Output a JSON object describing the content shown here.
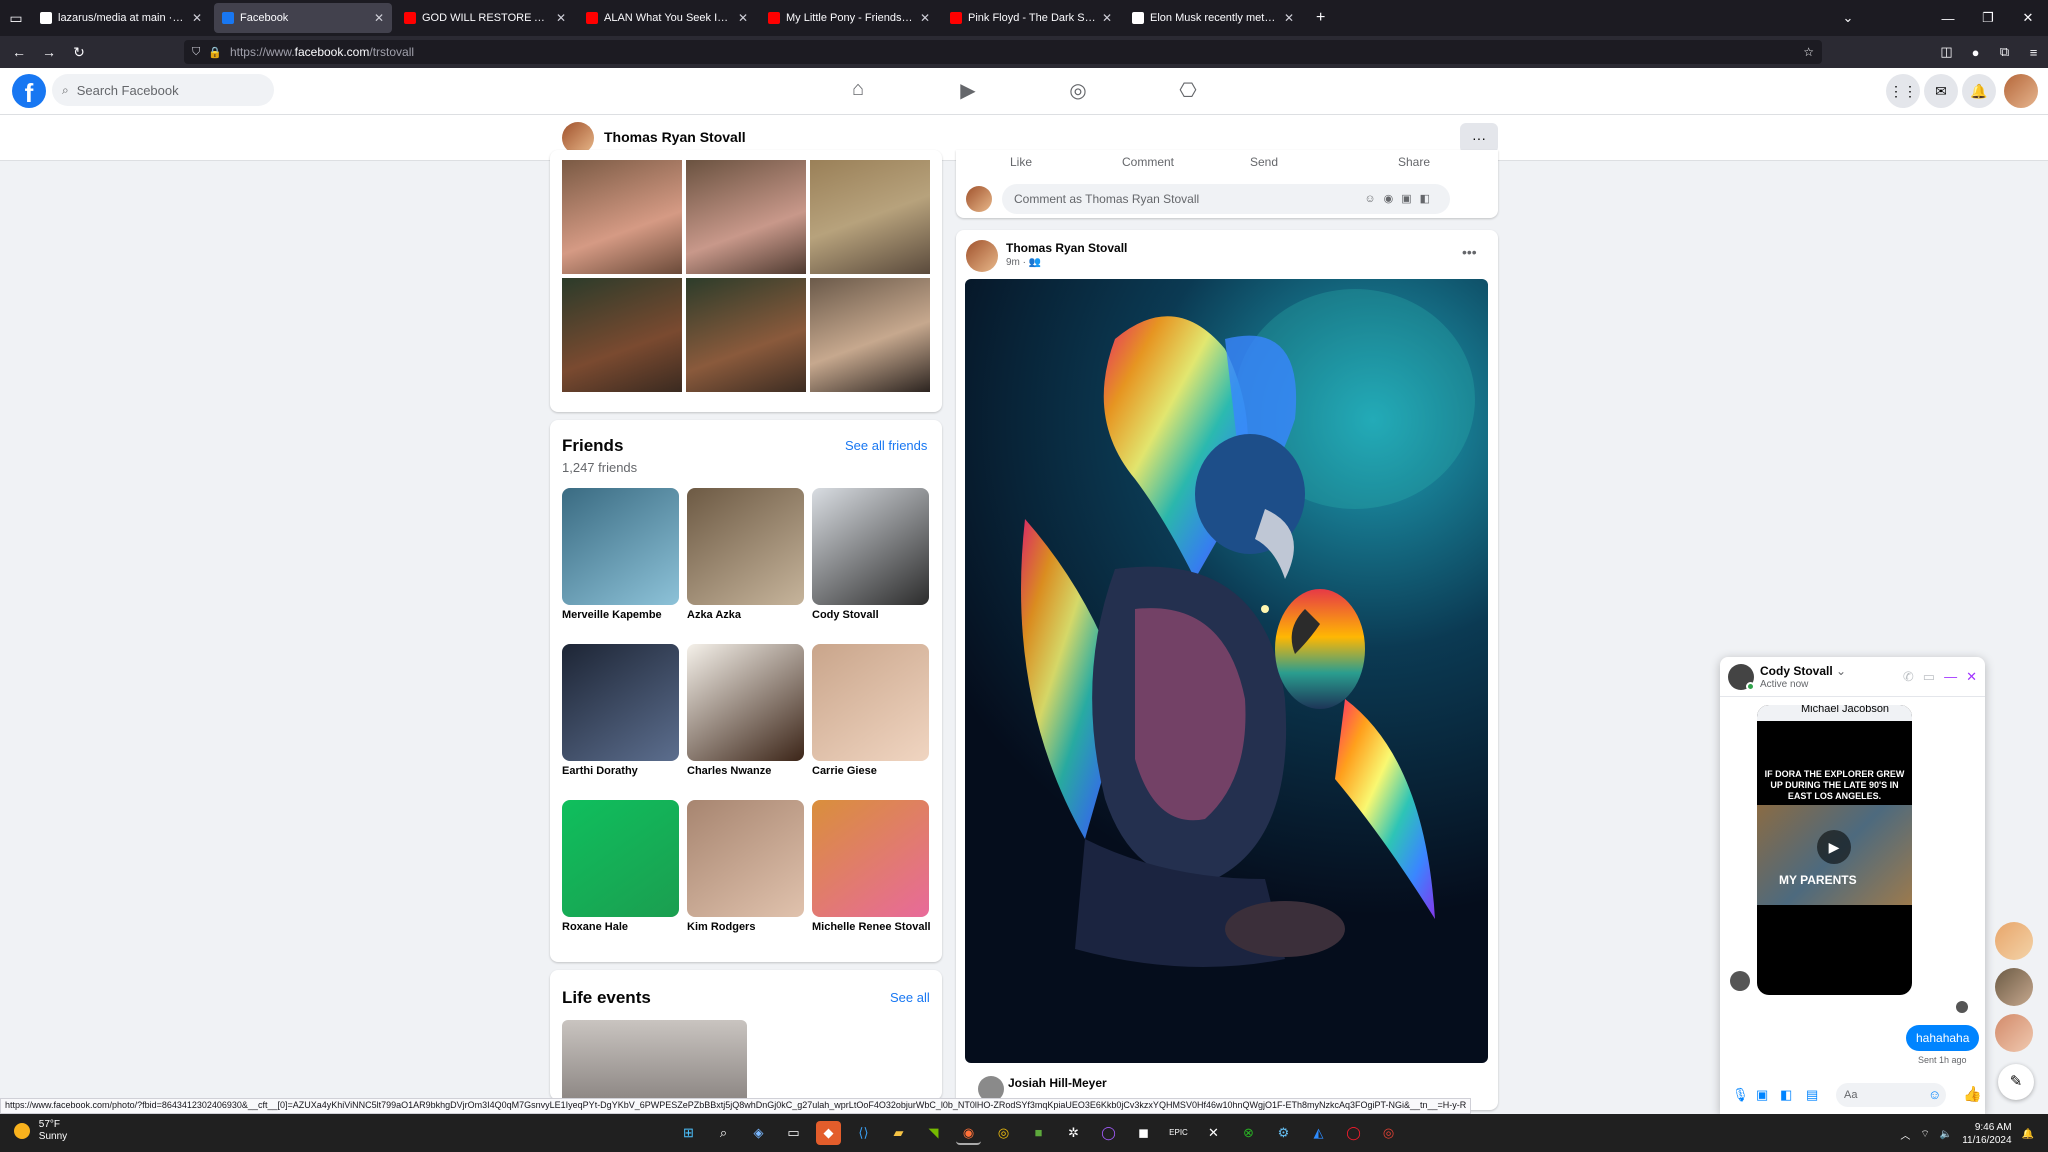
{
  "browser": {
    "tabs": [
      {
        "title": "lazarus/media at main · trstovall",
        "color": "#ffffff",
        "active": false
      },
      {
        "title": "Facebook",
        "color": "#1877f2",
        "active": true
      },
      {
        "title": "GOD WILL RESTORE ALL YOUR",
        "color": "#ff0000",
        "active": false
      },
      {
        "title": "ALAN What You Seek Is Seeking",
        "color": "#ff0000",
        "active": false
      },
      {
        "title": "My Little Pony - Friendship Is M",
        "color": "#ff0000",
        "active": false
      },
      {
        "title": "Pink Floyd - The Dark Side of th",
        "color": "#ff0000",
        "active": false
      },
      {
        "title": "Elon Musk recently met with Ira",
        "color": "#ffffff",
        "active": false
      }
    ],
    "url_prefix": "https://www.",
    "url_domain": "facebook.com",
    "url_path": "/trstovall",
    "status_url": "https://www.facebook.com/photo/?fbid=8643412302406930&__cft__[0]=AZUXa4yKhiViNNC5lt799aO1AR9bkhgDVjrOm3I4Q0qM7GsnvyLE1IyeqPYt-DgYKbV_6PWPESZePZbBBxtj5jQ8whDnGj0kC_g27ulah_wprLtOoF4O32objurWbC_l0b_NT0lHO-ZRodSYf3mqKpiaUEO3E6Kkb0jCv3kzxYQHMSV0Hf46w10hnQWgjO1F-ETh8myNzkcAq3FOgiPT-NGi&__tn__=H-y-R"
  },
  "facebook": {
    "search_placeholder": "Search Facebook",
    "profile_name": "Thomas Ryan Stovall",
    "more_label": "···",
    "friends": {
      "title": "Friends",
      "count": "1,247 friends",
      "see_all": "See all friends",
      "list": [
        {
          "name": "Merveille Kapembe",
          "c1": "#3a6b82",
          "c2": "#8dc2d8"
        },
        {
          "name": "Azka Azka",
          "c1": "#6d5a44",
          "c2": "#c6b49b"
        },
        {
          "name": "Cody Stovall",
          "c1": "#d9dde2",
          "c2": "#2c2c2c"
        },
        {
          "name": "Earthi Dorathy",
          "c1": "#1d2535",
          "c2": "#5c6e8e"
        },
        {
          "name": "Charles Nwanze",
          "c1": "#f5f1ea",
          "c2": "#3c2518"
        },
        {
          "name": "Carrie Giese",
          "c1": "#c9a58b",
          "c2": "#f0d5c1"
        },
        {
          "name": "Roxane Hale",
          "c1": "#0fbf5d",
          "c2": "#1b9e50"
        },
        {
          "name": "Kim Rodgers",
          "c1": "#a78570",
          "c2": "#e0c2ad"
        },
        {
          "name": "Michelle Renee Stovall",
          "c1": "#d98f3b",
          "c2": "#e86a9a"
        }
      ]
    },
    "life_events": {
      "title": "Life events",
      "see_all": "See all"
    },
    "post_actions": [
      "Like",
      "Comment",
      "Send",
      "Share"
    ],
    "comment_placeholder": "Comment as Thomas Ryan Stovall",
    "post": {
      "author": "Thomas Ryan Stovall",
      "time": "9m",
      "commenter": "Josiah Hill-Meyer"
    }
  },
  "chat": {
    "name": "Cody Stovall",
    "status": "Active now",
    "shared_from": "Michael Jacobson",
    "video_caption": "IF DORA THE EXPLORER GREW UP DURING THE LATE 90'S IN EAST LOS ANGELES.",
    "video_overlay": "MY PARENTS",
    "message": "hahahaha",
    "sent_label": "Sent 1h ago",
    "input_placeholder": "Aa"
  },
  "taskbar": {
    "temperature": "57°F",
    "condition": "Sunny",
    "time": "9:46 AM",
    "date": "11/16/2024"
  }
}
